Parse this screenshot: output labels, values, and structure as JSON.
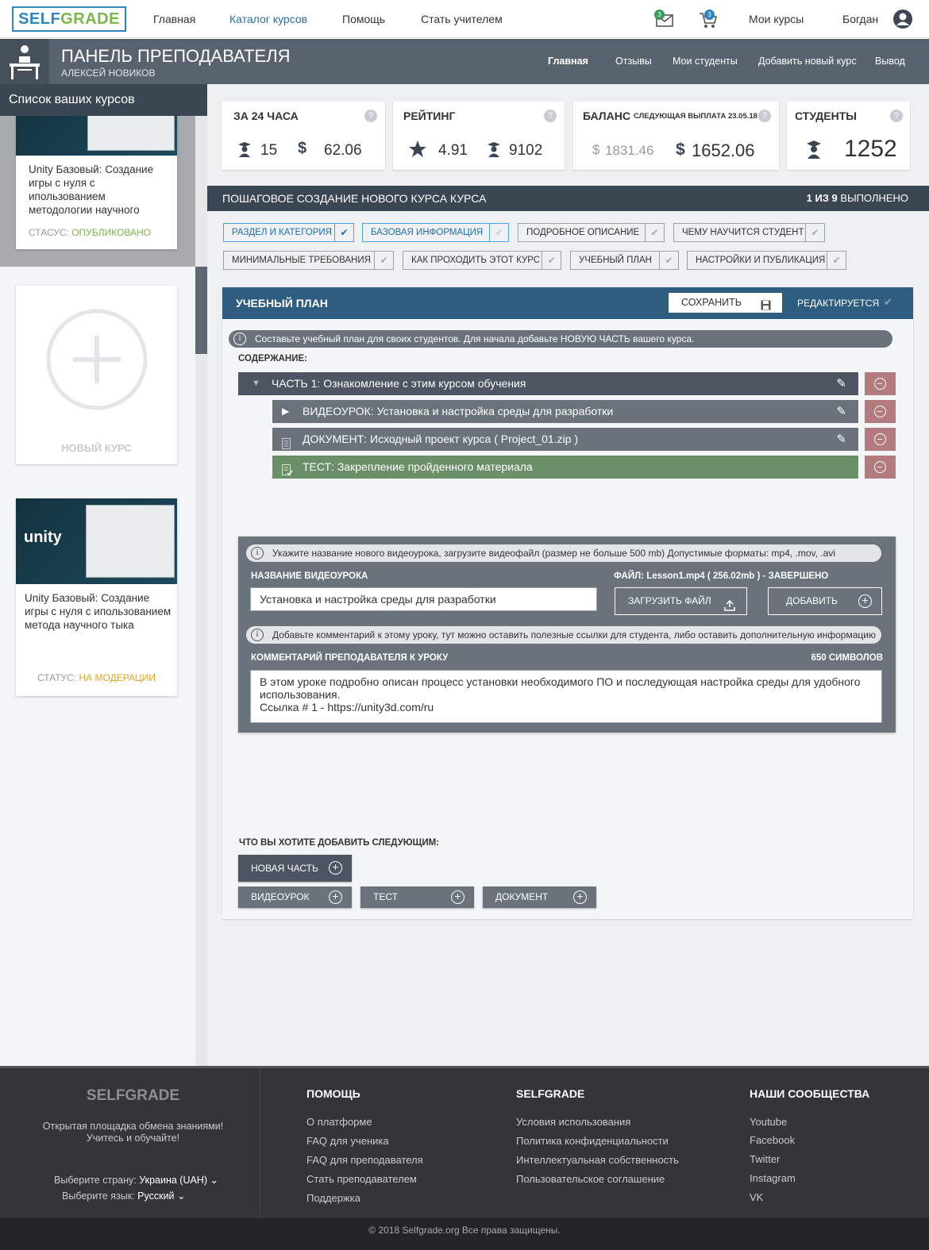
{
  "topnav": {
    "logo_a": "SELF",
    "logo_b": "GRADE",
    "links": [
      "Главная",
      "Каталог курсов",
      "Помощь",
      "Стать учителем"
    ],
    "mail_badge": "3",
    "cart_badge": "3",
    "my_courses": "Мои курсы",
    "user": "Богдан"
  },
  "panel": {
    "title": "ПАНЕЛЬ ПРЕПОДАВАТЕЛЯ",
    "subtitle": "АЛЕКСЕЙ НОВИКОВ",
    "nav": [
      "Главная",
      "Отзывы",
      "Мои студенты",
      "Добавить новый курс",
      "Вывод"
    ]
  },
  "sidebar": {
    "heading": "Список ваших курсов",
    "courses": [
      {
        "title": "Unity Базовый: Создание игры с нуля с ипользованием методологии научного",
        "status_label": "СТАСУС:",
        "status": "ОПУБЛИКОВАНО",
        "status_color": "#7ab648"
      },
      {
        "title": "Unity Базовый: Создание игры с нуля с ипользованием метода научного тыка",
        "status_label": "СТАТУС:",
        "status": "НА МОДЕРАЦИИ",
        "status_color": "#e0a526"
      }
    ],
    "new_course": "НОВЫЙ КУРС",
    "unity_logo": "unity"
  },
  "stats": {
    "day": {
      "title": "ЗА 24 ЧАСА",
      "students": "15",
      "money": "62.06"
    },
    "rating": {
      "title": "РЕЙТИНГ",
      "rating": "4.91",
      "students": "9102"
    },
    "balance": {
      "title": "БАЛАНС",
      "next": "СЛЕДУЮЩАЯ ВЫПЛАТА 23.05.18",
      "pending": "1831.46",
      "available": "1652.06"
    },
    "students": {
      "title": "СТУДЕНТЫ",
      "count": "1252"
    },
    "help": "?"
  },
  "wizard": {
    "title": "ПОШАГОВОЕ СОЗДАНИЕ НОВОГО КУРСА КУРСА",
    "progress_bold": "1 ИЗ 9",
    "progress_rest": "ВЫПОЛНЕНО",
    "steps": [
      "РАЗДЕЛ И КАТЕГОРИЯ",
      "БАЗОВАЯ ИНФОРМАЦИЯ",
      "ПОДРОБНОЕ ОПИСАНИЕ",
      "ЧЕМУ НАУЧИТСЯ СТУДЕНТ",
      "МИНИМАЛЬНЫЕ ТРЕБОВАНИЯ",
      "КАК ПРОХОДИТЬ ЭТОТ КУРС",
      "УЧЕБНЫЙ ПЛАН",
      "НАСТРОЙКИ И ПУБЛИКАЦИЯ"
    ]
  },
  "plan": {
    "title": "УЧЕБНЫЙ ПЛАН",
    "save": "СОХРАНИТЬ",
    "editing": "РЕДАКТИРУЕТСЯ",
    "hint": "Составьте учебный план для своих студентов. Для начала добавьте НОВУЮ ЧАСТЬ вашего курса.",
    "contents_label": "СОДЕРЖАНИЕ:",
    "part": {
      "prefix": "ЧАСТЬ 1:",
      "text": "Ознакомление с этим курсом обучения"
    },
    "items": [
      {
        "prefix": "ВИДЕОУРОК:",
        "text": "Установка и настройка среды для разработки"
      },
      {
        "prefix": "ДОКУМЕНТ:",
        "text": "Исходный проект курса (",
        "bold": "Project_01.zip",
        "after": ")"
      },
      {
        "prefix": "ТЕСТ:",
        "text": "Закрепление пройденного материала"
      }
    ]
  },
  "editor": {
    "hint1": "Укажите название нового видеоурока, загрузите видеофайл (размер не больше 500 mb) Допустимые форматы: mp4, .mov, .avi",
    "name_label": "НАЗВАНИЕ ВИДЕОУРОКА",
    "name_value": "Установка и настройка среды для разработки",
    "file_label": "ФАЙЛ: Lesson1.mp4 ( 256.02mb ) - ЗАВЕРШЕНО",
    "upload": "ЗАГРУЗИТЬ ФАЙЛ",
    "add": "ДОБАВИТЬ",
    "hint2": "Добавьте комментарий к этому уроку, тут можно оставить полезные ссылки для студента, либо оставить дополнительную информацию",
    "comment_label": "КОММЕНТАРИЙ ПРЕПОДАВАТЕЛЯ К УРОКУ",
    "chars": "650 СИМВОЛОВ",
    "comment_line1": "В этом уроке подробно описан процесс установки необходимого ПО и последующая настройка среды для удобного использования.",
    "comment_line2": "Ссылка # 1 - https://unity3d.com/ru"
  },
  "next": {
    "label": "ЧТО ВЫ ХОТИТЕ ДОБАВИТЬ СЛЕДУЮЩИМ:",
    "new_part": "НОВАЯ ЧАСТЬ",
    "video": "ВИДЕОУРОК",
    "test": "ТЕСТ",
    "doc": "ДОКУМЕНТ"
  },
  "footer": {
    "brand": "SELFGRADE",
    "tagline1": "Открытая площадка обмена знаниями!",
    "tagline2": "Учитесь и обучайте!",
    "country_label": "Выберите страну:",
    "country": "Украина (UAH)",
    "lang_label": "Выберите язык:",
    "lang": "Русский",
    "help_title": "ПОМОЩЬ",
    "help_links": [
      "О платформе",
      "FAQ для ученика",
      "FAQ для преподавателя",
      "Стать преподавателем",
      "Поддержка"
    ],
    "sg_title": "SELFGRADE",
    "sg_links": [
      "Условия использования",
      "Политика конфиденциальности",
      "Интеллектуальная собственность",
      "Пользовательское соглашение"
    ],
    "comm_title": "НАШИ СООБЩЕСТВА",
    "comm_links": [
      "Youtube",
      "Facebook",
      "Twitter",
      "Instagram",
      "VK"
    ],
    "copyright": "© 2018 Selfgrade.org Все права защищены."
  }
}
